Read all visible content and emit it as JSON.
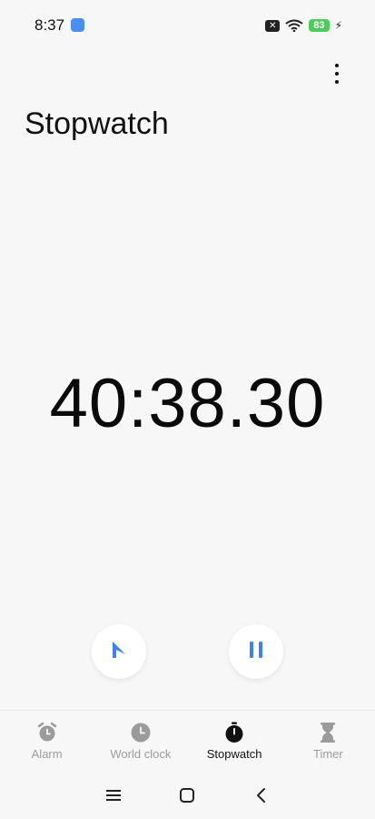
{
  "status_bar": {
    "time": "8:37",
    "battery_level": "83",
    "battery_color": "#4ccd5a"
  },
  "header": {
    "title": "Stopwatch",
    "more_icon": "vertical-dots-icon"
  },
  "stopwatch": {
    "elapsed": "40:38.30"
  },
  "controls": {
    "lap_icon": "flag-icon",
    "pause_icon": "pause-icon",
    "accent": "#3d7ff5"
  },
  "bottom_nav": {
    "items": [
      {
        "label": "Alarm",
        "icon": "alarm-clock-icon",
        "active": false
      },
      {
        "label": "World clock",
        "icon": "clock-icon",
        "active": false
      },
      {
        "label": "Stopwatch",
        "icon": "stopwatch-icon",
        "active": true
      },
      {
        "label": "Timer",
        "icon": "hourglass-icon",
        "active": false
      }
    ]
  },
  "system_nav": {
    "menu_icon": "menu-icon",
    "home_icon": "home-square-icon",
    "back_icon": "back-chevron-icon"
  }
}
